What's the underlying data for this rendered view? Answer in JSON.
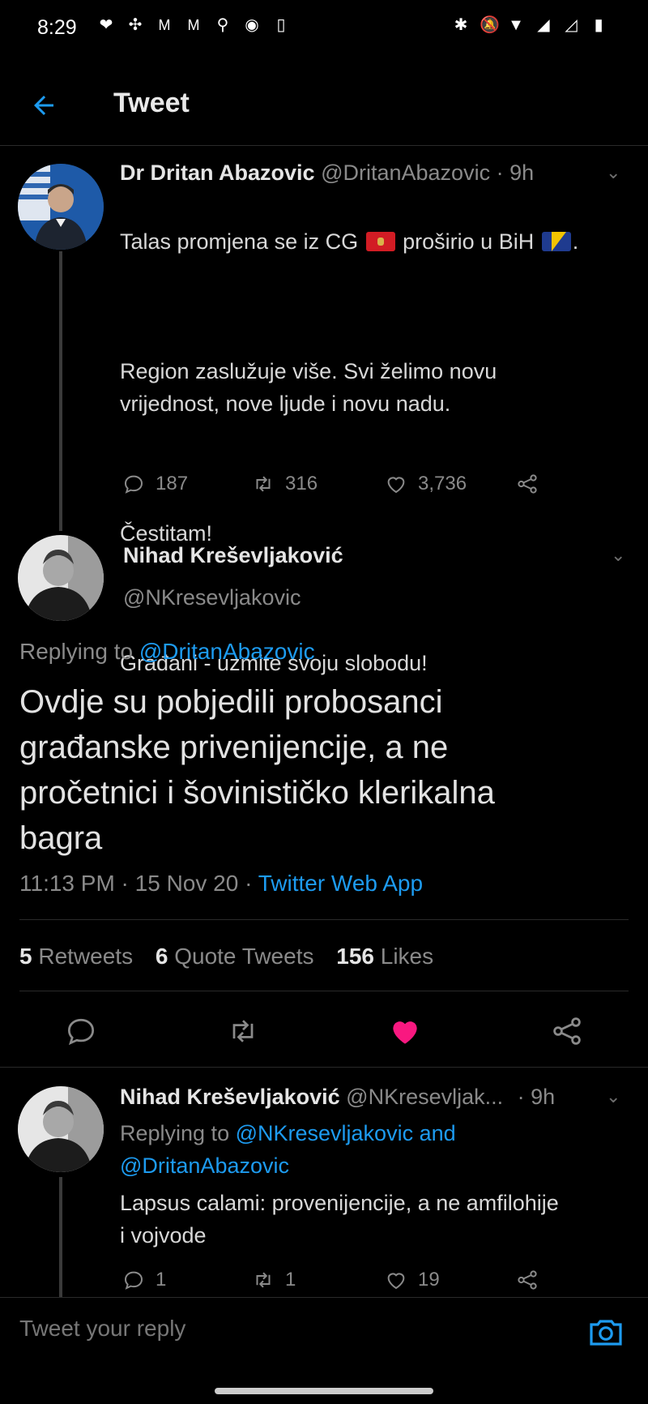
{
  "status_bar": {
    "time": "8:29",
    "left_icons": [
      "heart-rate-icon",
      "fan-icon",
      "gmail-icon",
      "gmail-icon",
      "keyhole-icon",
      "shazam-icon",
      "phone-icon"
    ],
    "right_icons": [
      "bluetooth-icon",
      "mute-icon",
      "wifi-icon",
      "signal-icon",
      "signal-icon",
      "battery-icon"
    ]
  },
  "header": {
    "title": "Tweet"
  },
  "parent_tweet": {
    "name": "Dr Dritan Abazovic",
    "handle": "@DritanAbazovic",
    "time": "· 9h",
    "text_line1_a": "Talas promjena se iz CG",
    "text_line1_b": "proširio u BiH",
    "text_line1_c": ".",
    "paragraphs": [
      "Region zaslužuje više. Svi želimo novu\nvrijednost, nove ljude i novu nadu.",
      "Čestitam!",
      "Građani - uzmite svoju slobodu!"
    ],
    "replies": "187",
    "retweets": "316",
    "likes": "3,736"
  },
  "main_tweet": {
    "name": "Nihad Kreševljaković",
    "handle": "@NKresevljakovic",
    "replying_prefix": "Replying to",
    "replying_to": "@DritanAbazovic",
    "text": "Ovdje su pobjedili probosanci\ngrađanske privenijencije, a ne\npročetnici i šovinističko klerikalna\nbagra",
    "timestamp": "11:13 PM · 15 Nov 20 ·",
    "source": "Twitter Web App",
    "retweets_count": "5",
    "retweets_label": "Retweets",
    "quote_count": "6",
    "quote_label": "Quote Tweets",
    "likes_count": "156",
    "likes_label": "Likes"
  },
  "reply_tweet": {
    "name": "Nihad Kreševljaković",
    "handle": "@NKresevljak...",
    "time": "· 9h",
    "replying_prefix": "Replying to",
    "replying_to": "@NKresevljakovic and\n@DritanAbazovic",
    "text": "Lapsus calami: provenijencije, a ne amfilohije\ni vojvode",
    "replies": "1",
    "retweets": "1",
    "likes": "19"
  },
  "reply_bar": {
    "placeholder": "Tweet your reply"
  },
  "colors": {
    "accent": "#1d9bf0",
    "like_active": "#f91880",
    "background": "#000000"
  }
}
